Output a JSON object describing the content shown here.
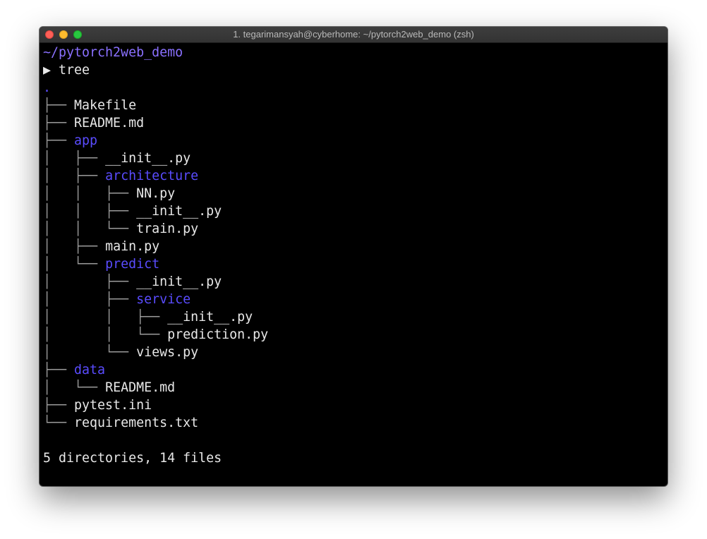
{
  "window": {
    "title": "1. tegarimansyah@cyberhome: ~/pytorch2web_demo (zsh)"
  },
  "prompt": {
    "path": "~/pytorch2web_demo",
    "arrow": "▶",
    "command": "tree"
  },
  "tree": [
    {
      "prefix": "",
      "name": ".",
      "kind": "dir"
    },
    {
      "prefix": "├── ",
      "name": "Makefile",
      "kind": "file"
    },
    {
      "prefix": "├── ",
      "name": "README.md",
      "kind": "file"
    },
    {
      "prefix": "├── ",
      "name": "app",
      "kind": "dir"
    },
    {
      "prefix": "│   ├── ",
      "name": "__init__.py",
      "kind": "file"
    },
    {
      "prefix": "│   ├── ",
      "name": "architecture",
      "kind": "dir"
    },
    {
      "prefix": "│   │   ├── ",
      "name": "NN.py",
      "kind": "file"
    },
    {
      "prefix": "│   │   ├── ",
      "name": "__init__.py",
      "kind": "file"
    },
    {
      "prefix": "│   │   └── ",
      "name": "train.py",
      "kind": "file"
    },
    {
      "prefix": "│   ├── ",
      "name": "main.py",
      "kind": "file"
    },
    {
      "prefix": "│   └── ",
      "name": "predict",
      "kind": "dir"
    },
    {
      "prefix": "│       ├── ",
      "name": "__init__.py",
      "kind": "file"
    },
    {
      "prefix": "│       ├── ",
      "name": "service",
      "kind": "dir"
    },
    {
      "prefix": "│       │   ├── ",
      "name": "__init__.py",
      "kind": "file"
    },
    {
      "prefix": "│       │   └── ",
      "name": "prediction.py",
      "kind": "file"
    },
    {
      "prefix": "│       └── ",
      "name": "views.py",
      "kind": "file"
    },
    {
      "prefix": "├── ",
      "name": "data",
      "kind": "dir"
    },
    {
      "prefix": "│   └── ",
      "name": "README.md",
      "kind": "file"
    },
    {
      "prefix": "├── ",
      "name": "pytest.ini",
      "kind": "file"
    },
    {
      "prefix": "└── ",
      "name": "requirements.txt",
      "kind": "file"
    }
  ],
  "summary": "5 directories, 14 files",
  "colors": {
    "background": "#000000",
    "text": "#e8e8e8",
    "path": "#8a70ff",
    "directory": "#5a4cff",
    "tree_guides": "#9a9a9a"
  }
}
